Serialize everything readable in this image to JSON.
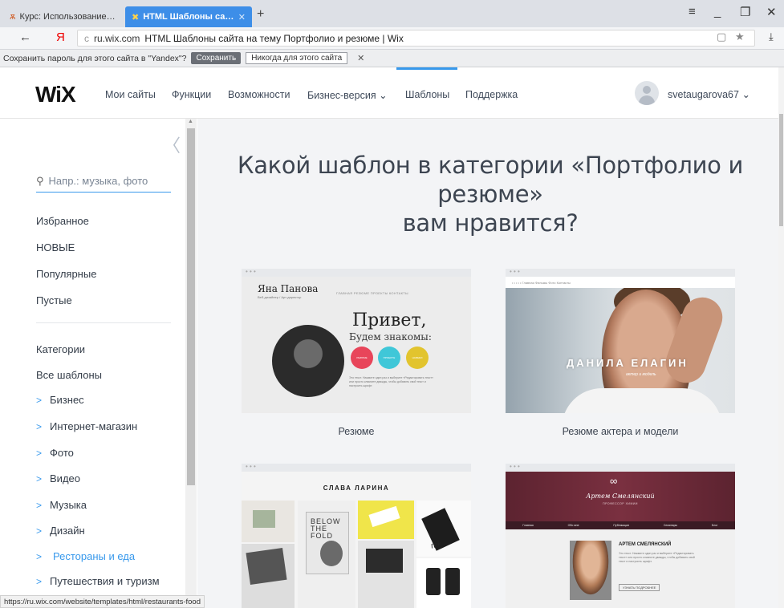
{
  "browser": {
    "tabs": [
      {
        "icon": "ѫ",
        "title": "Курс: Использование серв"
      },
      {
        "icon": "✖",
        "title": "HTML Шаблоны сайта на"
      }
    ],
    "new_tab": "+",
    "window_controls": {
      "menu": "≡",
      "minimize": "_",
      "restore": "❐",
      "close": "✕"
    },
    "nav": {
      "back": "←",
      "yandex": "Я"
    },
    "address": {
      "reload": "c",
      "domain": "ru.wix.com",
      "title": "HTML Шаблоны сайта на тему Портфолио и резюме | Wix"
    },
    "address_right": {
      "reader": "▢",
      "star": "★",
      "download": "⤓"
    },
    "password_bar": {
      "text": "Сохранить пароль для этого сайта в \"Yandex\"?",
      "save": "Сохранить",
      "never": "Никогда для этого сайта",
      "close": "✕"
    },
    "status_url": "https://ru.wix.com/website/templates/html/restaurants-food"
  },
  "header": {
    "logo": "WiX",
    "menu": [
      "Мои сайты",
      "Функции",
      "Возможности",
      "Бизнес-версия",
      "Шаблоны",
      "Поддержка"
    ],
    "business_chevron": "⌄",
    "username": "svetaugarova67",
    "user_chevron": "⌄",
    "accent": "#3899ec"
  },
  "sidebar": {
    "collapse_icon": "〈",
    "search": {
      "icon": "⚲",
      "placeholder": "Напр.: музыка, фото"
    },
    "filters": [
      "Избранное",
      "НОВЫЕ",
      "Популярные",
      "Пустые"
    ],
    "categories_heading": "Категории",
    "all_templates": "Все шаблоны",
    "chevron": ">",
    "categories": [
      "Бизнес",
      "Интернет-магазин",
      "Фото",
      "Видео",
      "Музыка",
      "Дизайн",
      "Рестораны и еда",
      "Путешествия и туризм"
    ],
    "active_category": "Рестораны и еда"
  },
  "main": {
    "heading_line1": "Какой шаблон в категории «Портфолио и",
    "heading_line2": "резюме»",
    "heading_line3": "вам нравится?",
    "cards": [
      {
        "caption": "Резюме",
        "preview": {
          "name": "Яна Панова",
          "subtitle": "Веб-дизайнер / Арт-директор",
          "nav": "ГЛАВНАЯ  РЕЗЮМЕ  ПРОЕКТЫ  КОНТАКТЫ",
          "hello": "Привет,",
          "sub_hello": "Будем знакомы:",
          "bubbles": [
            "РЕЗЮМЕ",
            "ПРОЕКТЫ",
            "НАВЫКИ"
          ],
          "bubble_colors": [
            "#e8455a",
            "#3fc7d8",
            "#e2c42e"
          ],
          "text": "Это текст. Нажмите один раз и выберите «Редактировать текст» или просто кликните дважды, чтобы добавить свой текст и настроить шрифт."
        }
      },
      {
        "caption": "Резюме актера и модели",
        "preview": {
          "nav": "• • • • •                    Главная   Фильмы   Фото   Контакты",
          "name": "ДАНИЛА ЕЛАГИН",
          "role": "актер и модель"
        }
      },
      {
        "caption": "",
        "preview": {
          "name": "СЛАВА ЛАРИНА",
          "poster_text": "BELOW\nTHE\nFOLD",
          "cup_text": "mk"
        }
      },
      {
        "caption": "",
        "preview": {
          "molecule": "∞",
          "name": "Артем Смелянский",
          "subtitle": "ПРОФЕССОР ХИМИИ",
          "nav": [
            "Главная",
            "Обо мне",
            "Публикации",
            "Семинары",
            "Блог"
          ],
          "title": "АРТЕМ СМЕЛЯНСКИЙ",
          "text": "Это текст. Нажмите один раз и выберите «Редактировать текст» или просто кликните дважды, чтобы добавить свой текст и настроить шрифт.",
          "button": "УЗНАТЬ ПОДРОБНЕЕ"
        }
      }
    ]
  }
}
